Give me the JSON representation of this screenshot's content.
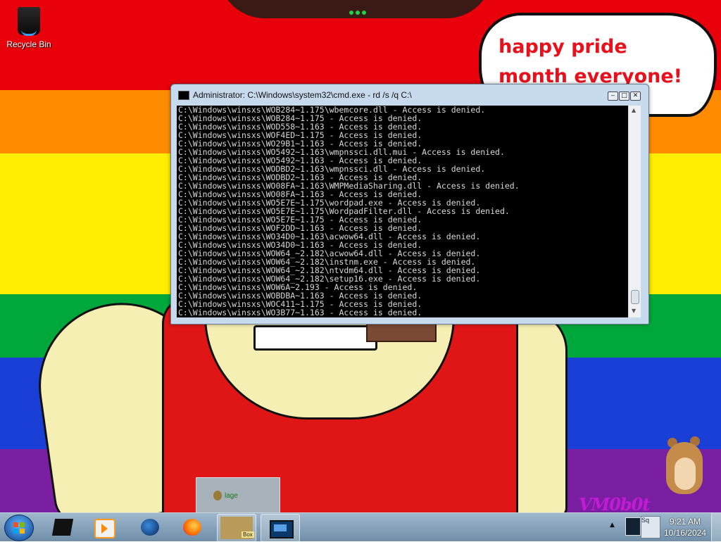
{
  "desktop": {
    "recycle_bin_label": "Recycle Bin",
    "bubble_text": "happy pride month everyone!",
    "watermark": "VM0b0t",
    "preview_label": "lage",
    "wallpaper_colors": [
      "#e8000b",
      "#ff8c00",
      "#ffed00",
      "#00a73b",
      "#1a3fd6",
      "#7b1fa2"
    ]
  },
  "cmd_window": {
    "title": "Administrator: C:\\Windows\\system32\\cmd.exe - rd  /s /q C:\\",
    "lines": [
      "C:\\Windows\\winsxs\\WOB284~1.175\\wbemcore.dll - Access is denied.",
      "C:\\Windows\\winsxs\\WOB284~1.175 - Access is denied.",
      "C:\\Windows\\winsxs\\WOD558~1.163 - Access is denied.",
      "C:\\Windows\\winsxs\\WOF4ED~1.175 - Access is denied.",
      "C:\\Windows\\winsxs\\WO29B1~1.163 - Access is denied.",
      "C:\\Windows\\winsxs\\WO5492~1.163\\wmpnssci.dll.mui - Access is denied.",
      "C:\\Windows\\winsxs\\WO5492~1.163 - Access is denied.",
      "C:\\Windows\\winsxs\\WODBD2~1.163\\wmpnssci.dll - Access is denied.",
      "C:\\Windows\\winsxs\\WODBD2~1.163 - Access is denied.",
      "C:\\Windows\\winsxs\\WO08FA~1.163\\WMPMediaSharing.dll - Access is denied.",
      "C:\\Windows\\winsxs\\WO08FA~1.163 - Access is denied.",
      "C:\\Windows\\winsxs\\WO5E7E~1.175\\wordpad.exe - Access is denied.",
      "C:\\Windows\\winsxs\\WO5E7E~1.175\\WordpadFilter.dll - Access is denied.",
      "C:\\Windows\\winsxs\\WO5E7E~1.175 - Access is denied.",
      "C:\\Windows\\winsxs\\WOF2DD~1.163 - Access is denied.",
      "C:\\Windows\\winsxs\\WO34D0~1.163\\acwow64.dll - Access is denied.",
      "C:\\Windows\\winsxs\\WO34D0~1.163 - Access is denied.",
      "C:\\Windows\\winsxs\\WOW64_~2.182\\acwow64.dll - Access is denied.",
      "C:\\Windows\\winsxs\\WOW64_~2.182\\instnm.exe - Access is denied.",
      "C:\\Windows\\winsxs\\WOW64_~2.182\\ntvdm64.dll - Access is denied.",
      "C:\\Windows\\winsxs\\WOW64_~2.182\\setup16.exe - Access is denied.",
      "C:\\Windows\\winsxs\\WOW6A~2.193 - Access is denied.",
      "C:\\Windows\\winsxs\\WOBDBA~1.163 - Access is denied.",
      "C:\\Windows\\winsxs\\WOC411~1.175 - Access is denied.",
      "C:\\Windows\\winsxs\\WO3B77~1.163 - Access is denied."
    ],
    "buttons": {
      "minimize": "‒",
      "maximize": "□",
      "close": "✕"
    }
  },
  "taskbar": {
    "items": [
      {
        "name": "computer-icon",
        "active": false
      },
      {
        "name": "media-player-icon",
        "active": false
      },
      {
        "name": "globe-icon",
        "active": false
      },
      {
        "name": "firefox-icon",
        "active": false
      },
      {
        "name": "hamster-box-icon",
        "active": true
      },
      {
        "name": "cmd-icon",
        "active": true
      }
    ],
    "hamster_label": "Box",
    "tray_arrow": "▲",
    "tray_app_label": "Sq",
    "clock_time": "9:21 AM",
    "clock_date": "10/16/2024"
  }
}
